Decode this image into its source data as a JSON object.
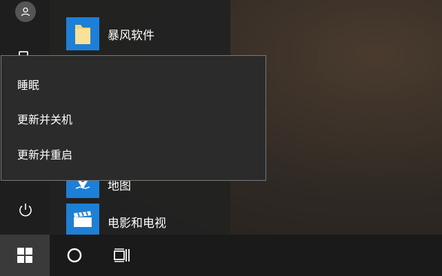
{
  "start_menu": {
    "apps": [
      {
        "label": "暴风软件",
        "icon": "folder-icon"
      },
      {
        "label": "地图",
        "icon": "maps-icon"
      },
      {
        "label": "电影和电视",
        "icon": "movies-tv-icon"
      }
    ]
  },
  "power_menu": {
    "items": [
      {
        "label": "睡眠"
      },
      {
        "label": "更新并关机"
      },
      {
        "label": "更新并重启"
      }
    ]
  },
  "taskbar": {
    "start_icon": "windows-logo-icon",
    "search_icon": "cortana-circle-icon",
    "taskview_icon": "task-view-icon"
  },
  "colors": {
    "accent": "#1e7fd6",
    "folder": "#f6d57a",
    "taskbar": "#1a1a1a"
  }
}
